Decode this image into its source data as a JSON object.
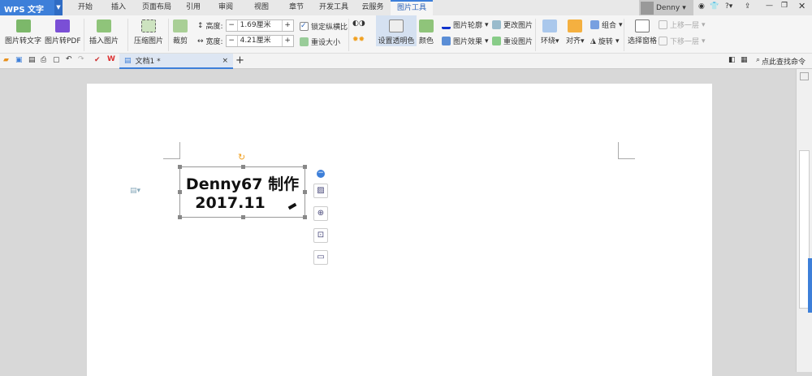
{
  "app": {
    "logo": "WPS 文字"
  },
  "tabs": [
    "开始",
    "插入",
    "页面布局",
    "引用",
    "审阅",
    "视图",
    "章节",
    "开发工具",
    "云服务",
    "图片工具"
  ],
  "active_tab": "图片工具",
  "user": {
    "name": "Denny"
  },
  "ribbon": {
    "pic_to_text": "图片转文字",
    "pic_to_pdf": "图片转PDF",
    "insert_pic": "插入图片",
    "compress": "压缩图片",
    "crop": "裁剪",
    "height_label": "高度:",
    "height_value": "1.69厘米",
    "width_label": "宽度:",
    "width_value": "4.21厘米",
    "lock_ratio": "锁定纵横比",
    "reset_size": "重设大小",
    "set_transparent": "设置透明色",
    "color": "颜色",
    "outline": "图片轮廓",
    "effects": "图片效果",
    "change_pic": "更改图片",
    "reset_pic": "重设图片",
    "wrap": "环绕",
    "align": "对齐",
    "group": "组合",
    "rotate": "旋转",
    "selection_pane": "选择窗格",
    "bring_forward": "上移一层",
    "send_backward": "下移一层",
    "minus": "−",
    "plus": "+"
  },
  "quickbar": {
    "doc_tab": "文档1 *",
    "search": "点此查找命令",
    "close": "×",
    "new_tab": "+"
  },
  "document": {
    "line1": "Denny67  制作",
    "line2": "2017.11"
  }
}
